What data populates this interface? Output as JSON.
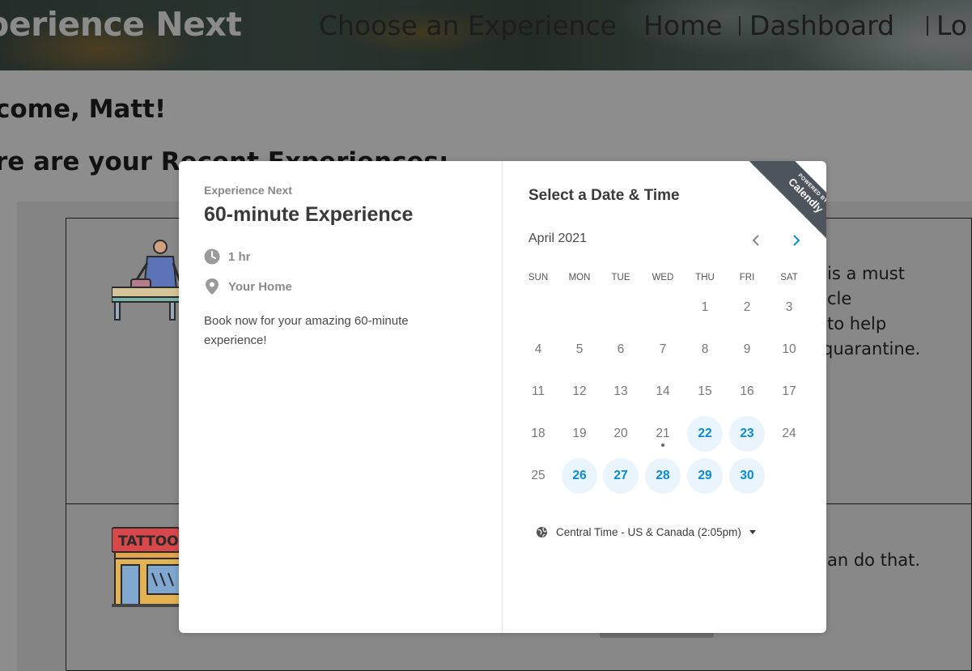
{
  "site": {
    "logo": "perience Next",
    "nav": [
      "Choose an Experience",
      "Home",
      "Dashboard",
      "Lo"
    ],
    "welcome": "come, Matt!",
    "recent_heading": "re are your Recent Experiences:",
    "card1_lines": [
      "is a must",
      "cle",
      "to help",
      "quarantine."
    ],
    "card2_line": "an do that.",
    "tattoo_sign": "TATTOO"
  },
  "modal": {
    "org_name": "Experience Next",
    "event_title": "60-minute Experience",
    "duration": "1 hr",
    "location": "Your Home",
    "description": "Book now for your amazing 60-minute experience!",
    "select_title": "Select a Date & Time",
    "month": "April 2021",
    "weekdays": [
      "SUN",
      "MON",
      "TUE",
      "WED",
      "THU",
      "FRI",
      "SAT"
    ],
    "timezone": "Central Time - US & Canada (2:05pm)",
    "ribbon_small": "POWERED BY",
    "ribbon_brand": "Calendly",
    "accent_color": "#0a8ad8",
    "available_bg": "#eaf4fc"
  },
  "calendar": {
    "first_weekday_index": 4,
    "days_in_month": 30,
    "available_days": [
      22,
      23,
      26,
      27,
      28,
      29,
      30
    ],
    "today": 21
  },
  "icons": {
    "duration": "clock-icon",
    "location": "map-pin-icon",
    "timezone": "globe-icon",
    "prev": "chevron-left-icon",
    "next": "chevron-right-icon",
    "dropdown": "caret-down-icon"
  }
}
